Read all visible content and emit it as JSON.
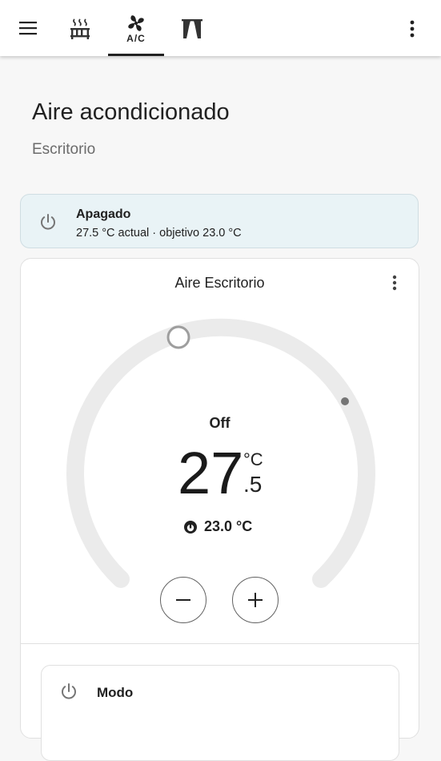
{
  "colors": {
    "accent": "#212121",
    "status_bg": "#e9f3f6",
    "dial_track": "#ebebeb",
    "card_bg": "#ffffff"
  },
  "topbar": {
    "menu_icon": "menu-icon",
    "tabs": [
      {
        "icon": "radiator-icon",
        "active": false
      },
      {
        "icon": "air-conditioner-icon",
        "text": "A/C",
        "active": true
      },
      {
        "icon": "curtains-icon",
        "active": false
      }
    ],
    "overflow_icon": "dots-vertical-icon"
  },
  "page": {
    "title": "Aire acondicionado",
    "subtitle": "Escritorio"
  },
  "status": {
    "icon": "power-icon",
    "title": "Apagado",
    "detail": "27.5 °C actual · objetivo 23.0 °C"
  },
  "thermostat": {
    "name": "Aire Escritorio",
    "hvac_state": "Off",
    "current_int": "27",
    "current_dec": ".5",
    "unit": "°C",
    "target": "23.0 °C",
    "target_icon": "thermostat-target-icon"
  },
  "controls": {
    "minus_icon": "minus-icon",
    "plus_icon": "plus-icon"
  },
  "mode": {
    "icon": "power-icon",
    "label": "Modo"
  }
}
